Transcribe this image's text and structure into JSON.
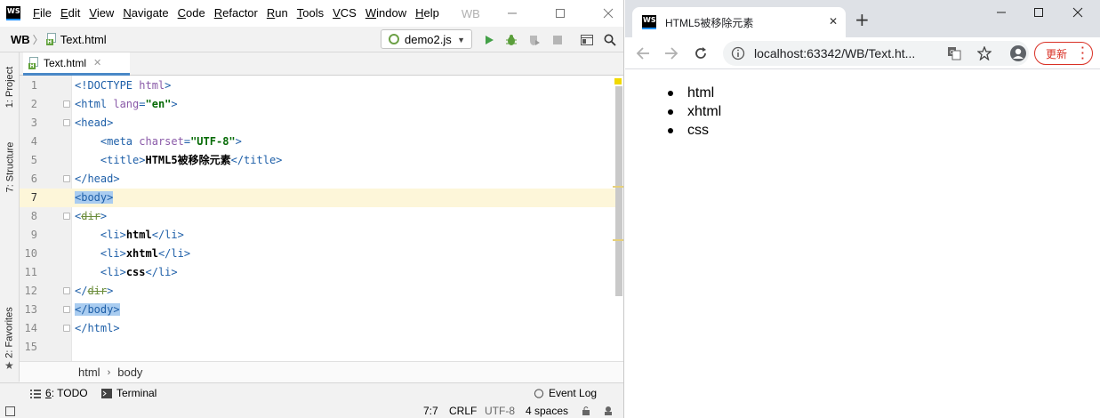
{
  "ide": {
    "app_label": "WB",
    "logo_text": "WS",
    "menu": [
      {
        "mnemonic": "F",
        "rest": "ile"
      },
      {
        "mnemonic": "E",
        "rest": "dit"
      },
      {
        "mnemonic": "V",
        "rest": "iew"
      },
      {
        "mnemonic": "N",
        "rest": "avigate"
      },
      {
        "mnemonic": "C",
        "rest": "ode"
      },
      {
        "mnemonic": "R",
        "rest": "efactor"
      },
      {
        "mnemonic": "R",
        "rest": "un"
      },
      {
        "mnemonic": "T",
        "rest": "ools"
      },
      {
        "mnemonic": "V",
        "rest": "CS"
      },
      {
        "mnemonic": "W",
        "rest": "indow"
      },
      {
        "mnemonic": "H",
        "rest": "elp"
      }
    ],
    "nav": {
      "project": "WB",
      "file": "Text.html"
    },
    "run_config": "demo2.js",
    "left_tabs": {
      "project": "1: Project",
      "structure": "7: Structure",
      "favorites": "2: Favorites"
    },
    "editor_tab": "Text.html",
    "current_line": 7,
    "code_lines": [
      {
        "n": "1",
        "html": "<span class='tag'>&lt;!DOCTYPE </span><span class='attr'>html</span><span class='tag'>&gt;</span>"
      },
      {
        "n": "2",
        "html": "<span class='tag'>&lt;html </span><span class='attr'>lang</span><span class='tag'>=</span><span class='val'>\"en\"</span><span class='tag'>&gt;</span>"
      },
      {
        "n": "3",
        "html": "<span class='tag'>&lt;head&gt;</span>"
      },
      {
        "n": "4",
        "html": "    <span class='tag'>&lt;meta </span><span class='attr'>charset</span><span class='tag'>=</span><span class='val'>\"UTF-8\"</span><span class='tag'>&gt;</span>"
      },
      {
        "n": "5",
        "html": "    <span class='tag'>&lt;title&gt;</span><span class='txt'>HTML5被移除元素</span><span class='tag'>&lt;/title&gt;</span>"
      },
      {
        "n": "6",
        "html": "<span class='tag'>&lt;/head&gt;</span>"
      },
      {
        "n": "7",
        "html": "<span class='hl'><span class='tag'>&lt;body&gt;</span></span>"
      },
      {
        "n": "8",
        "html": "<span class='tag'>&lt;</span><span class='strike'>dir</span><span class='tag'>&gt;</span>"
      },
      {
        "n": "9",
        "html": "    <span class='tag'>&lt;li&gt;</span><span class='txt'>html</span><span class='tag'>&lt;/li&gt;</span>"
      },
      {
        "n": "10",
        "html": "    <span class='tag'>&lt;li&gt;</span><span class='txt'>xhtml</span><span class='tag'>&lt;/li&gt;</span>"
      },
      {
        "n": "11",
        "html": "    <span class='tag'>&lt;li&gt;</span><span class='txt'>css</span><span class='tag'>&lt;/li&gt;</span>"
      },
      {
        "n": "12",
        "html": "<span class='tag'>&lt;/</span><span class='strike'>dir</span><span class='tag'>&gt;</span>"
      },
      {
        "n": "13",
        "html": "<span class='hl'><span class='tag'>&lt;/body&gt;</span></span>"
      },
      {
        "n": "14",
        "html": "<span class='tag'>&lt;/html&gt;</span>"
      },
      {
        "n": "15",
        "html": ""
      }
    ],
    "breadcrumb": [
      "html",
      "body"
    ],
    "tool_windows": {
      "todo_prefix": "6",
      "todo_rest": ": TODO",
      "terminal": "Terminal",
      "event_log": "Event Log"
    },
    "status": {
      "position": "7:7",
      "line_sep": "CRLF",
      "encoding": "UTF-8",
      "indent": "4 spaces"
    }
  },
  "browser": {
    "tab_title": "HTML5被移除元素",
    "url": "localhost:63342/WB/Text.ht...",
    "update_label": "更新",
    "list_items": [
      "html",
      "xhtml",
      "css"
    ]
  },
  "colors": {
    "accent": "#4a88c7",
    "run_green": "#43a047",
    "update_red": "#d93025"
  }
}
